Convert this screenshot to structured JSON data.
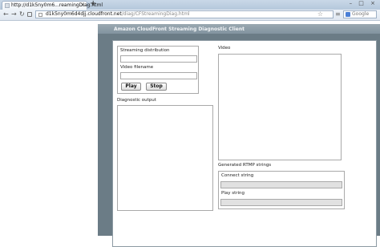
{
  "browser": {
    "tab_title": "http://d1k5ny0m6...reamingDiag.html",
    "tab_close": "×",
    "new_tab": "+",
    "window_controls": "– □ ×",
    "url_host": "d1k5ny0m6d4djj.cloudfront.net",
    "url_path": "/diag/CFStreamingDiag.html",
    "search_placeholder": "Google",
    "back": "←",
    "forward": "→",
    "reload": "↻",
    "star": "☆",
    "menu": "≡"
  },
  "app": {
    "title": "Amazon CloudFront Streaming Diagnostic Client",
    "streaming_distribution_label": "Streaming distribution",
    "streaming_distribution_value": "",
    "video_filename_label": "Video filename",
    "video_filename_value": "",
    "play_label": "Play",
    "stop_label": "Stop",
    "diagnostic_output_label": "Diagnostic output",
    "video_label": "Video",
    "rtmp_section_label": "Generated RTMP strings",
    "connect_string_label": "Connect string",
    "connect_string_value": "",
    "play_string_label": "Play string",
    "play_string_value": ""
  }
}
